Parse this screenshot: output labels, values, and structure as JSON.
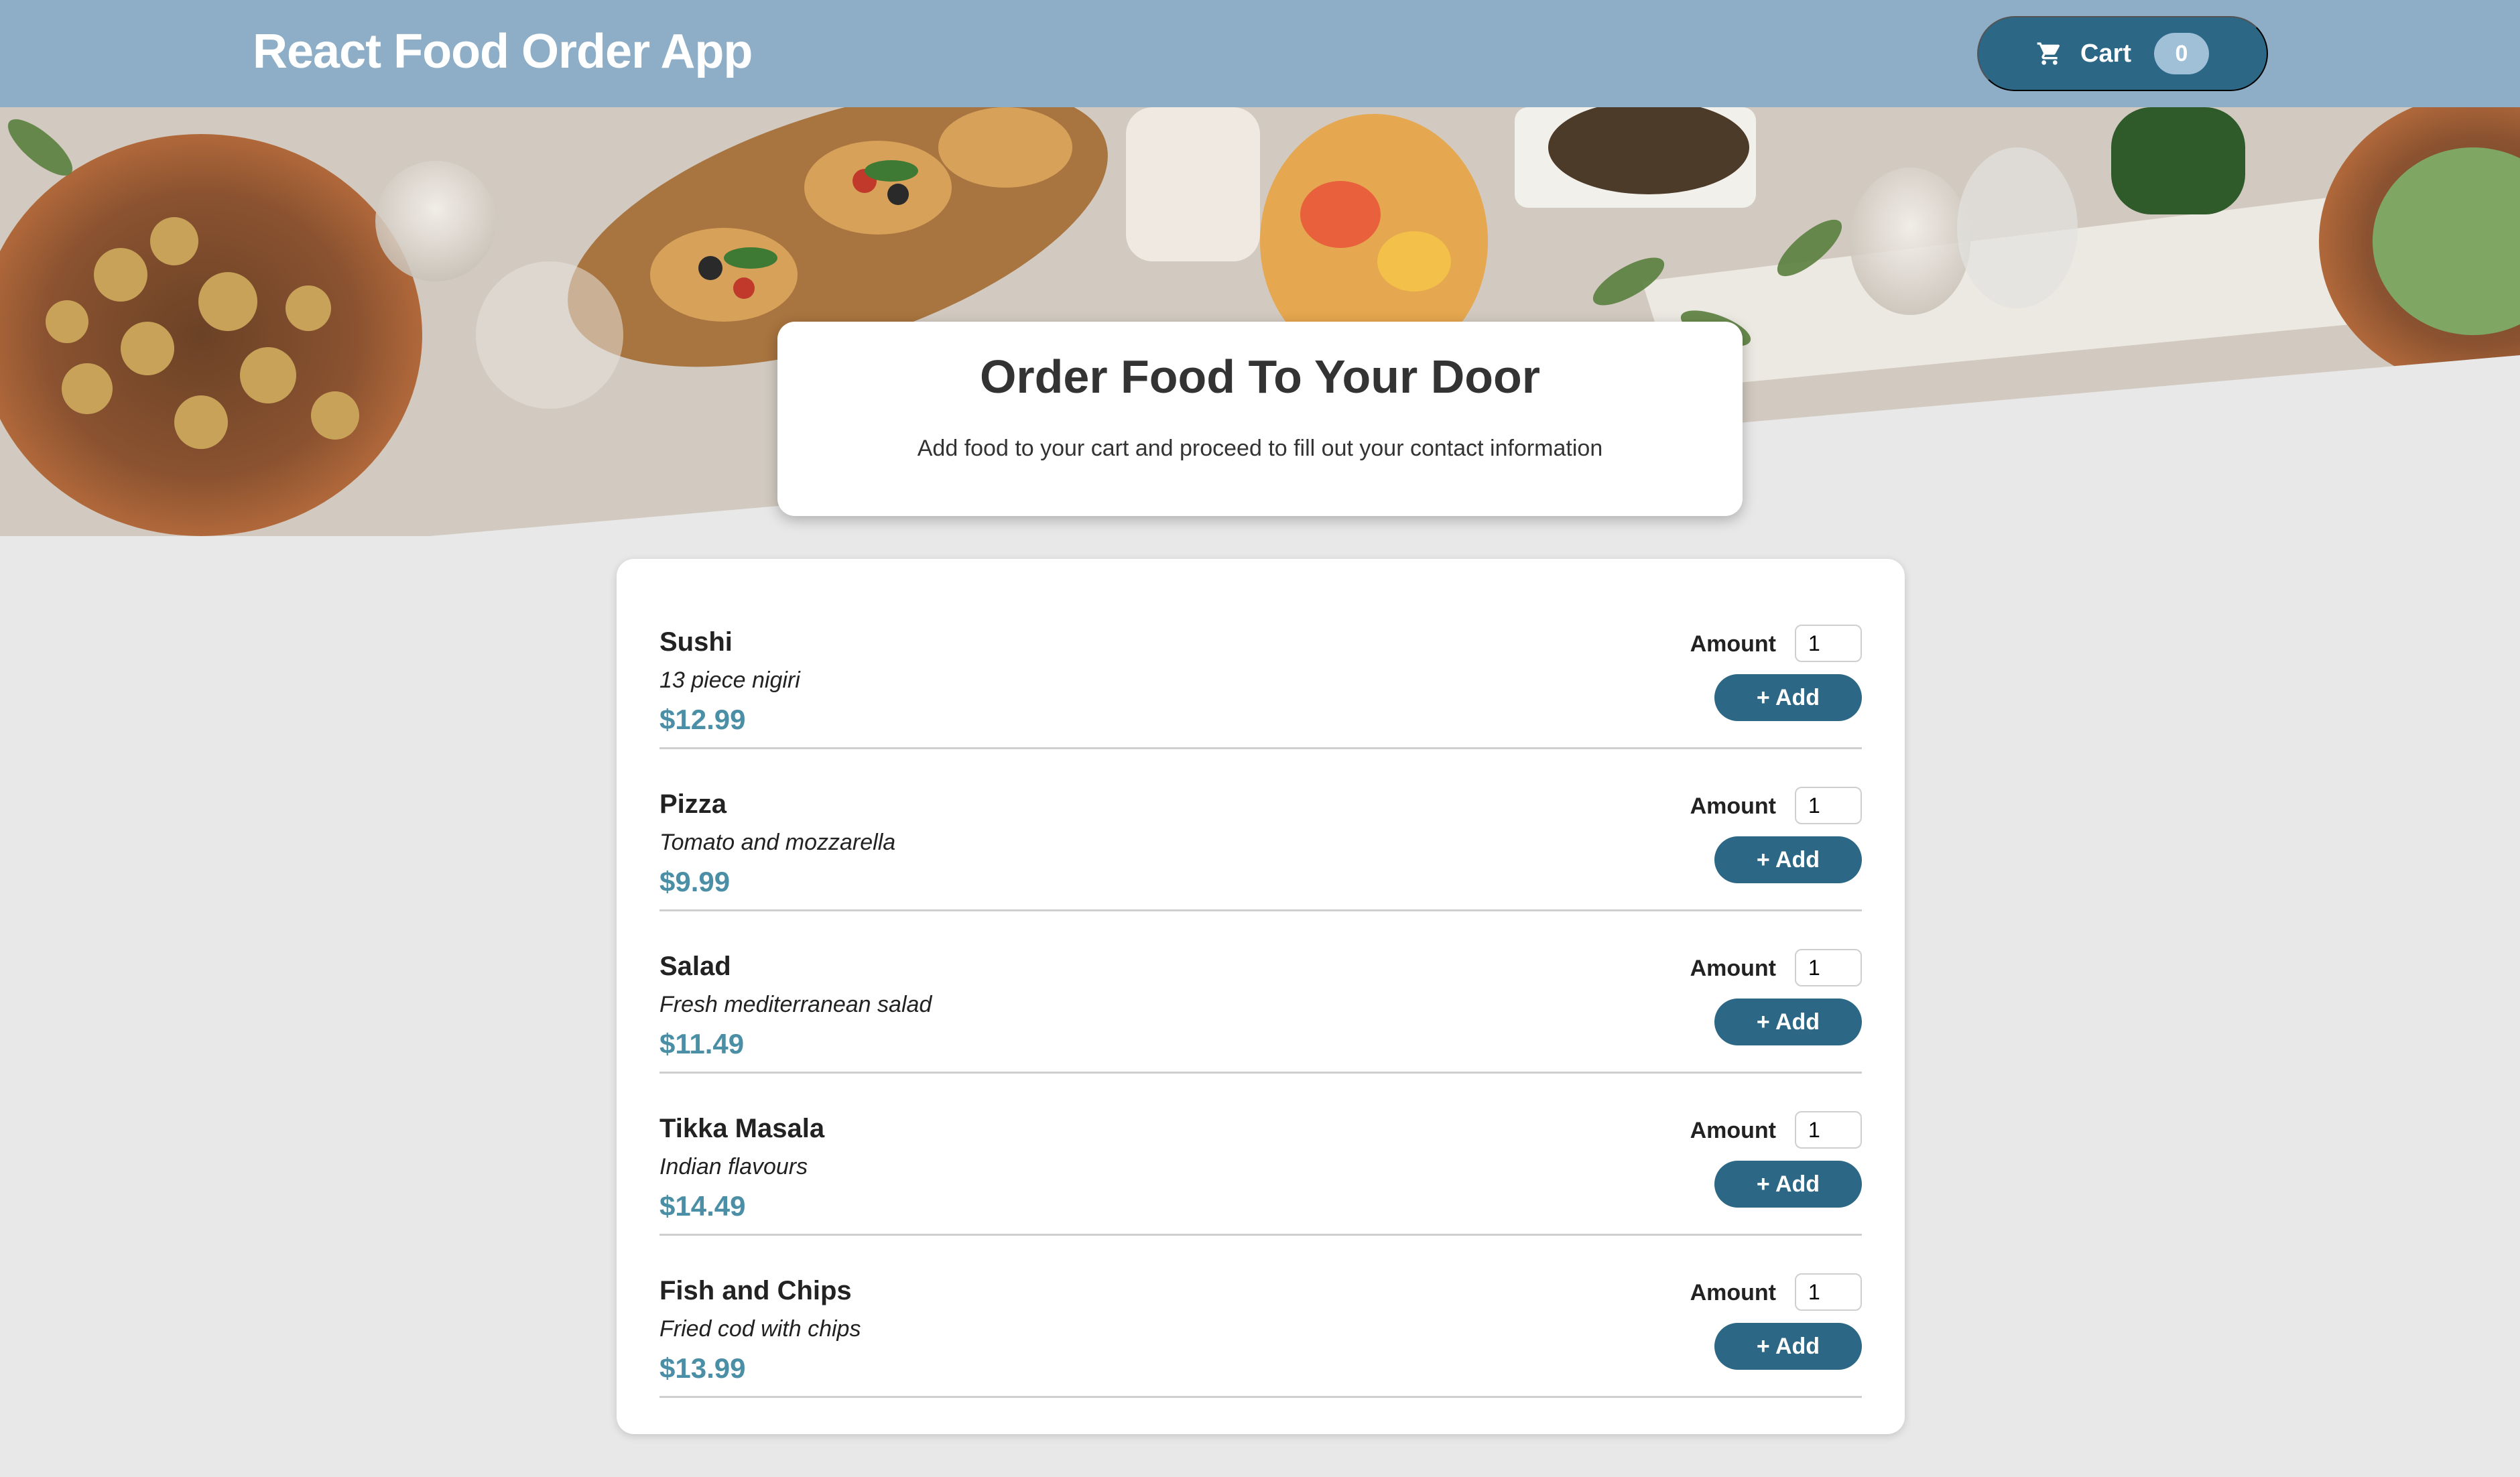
{
  "header": {
    "title": "React Food Order App",
    "cart_label": "Cart",
    "cart_count": "0"
  },
  "summary": {
    "title": "Order Food To Your Door",
    "text": "Add food to your cart and proceed to fill out your contact information"
  },
  "meals": [
    {
      "name": "Sushi",
      "description": "13 piece nigiri",
      "price": "$12.99",
      "amount_label": "Amount",
      "amount": "1",
      "add_label": "+ Add"
    },
    {
      "name": "Pizza",
      "description": "Tomato and mozzarella",
      "price": "$9.99",
      "amount_label": "Amount",
      "amount": "1",
      "add_label": "+ Add"
    },
    {
      "name": "Salad",
      "description": "Fresh mediterranean salad",
      "price": "$11.49",
      "amount_label": "Amount",
      "amount": "1",
      "add_label": "+ Add"
    },
    {
      "name": "Tikka Masala",
      "description": "Indian flavours",
      "price": "$14.49",
      "amount_label": "Amount",
      "amount": "1",
      "add_label": "+ Add"
    },
    {
      "name": "Fish and Chips",
      "description": "Fried cod with chips",
      "price": "$13.99",
      "amount_label": "Amount",
      "amount": "1",
      "add_label": "+ Add"
    }
  ],
  "colors": {
    "header": "#8daec6",
    "accent": "#2c6785",
    "price": "#4a8fa6",
    "background": "#e8e8e8"
  },
  "icons": {
    "cart": "cart-icon"
  }
}
